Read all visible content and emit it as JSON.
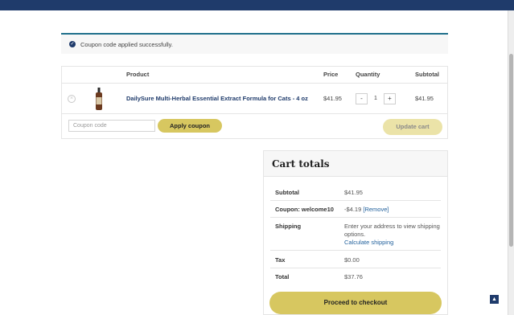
{
  "notice": {
    "message": "Coupon code applied successfully."
  },
  "cart": {
    "headers": {
      "product": "Product",
      "price": "Price",
      "quantity": "Quantity",
      "subtotal": "Subtotal"
    },
    "item": {
      "name": "DailySure Multi-Herbal Essential Extract Formula for Cats - 4 oz",
      "price": "$41.95",
      "quantity": "1",
      "subtotal": "$41.95",
      "minus": "-",
      "plus": "+"
    },
    "coupon_placeholder": "Coupon code",
    "apply_label": "Apply coupon",
    "update_label": "Update cart"
  },
  "totals": {
    "title": "Cart totals",
    "rows": {
      "subtotal": {
        "label": "Subtotal",
        "value": "$41.95"
      },
      "coupon": {
        "label": "Coupon: welcome10",
        "value": "-$4.19",
        "remove": "[Remove]"
      },
      "shipping": {
        "label": "Shipping",
        "value": "Enter your address to view shipping options.",
        "link": "Calculate shipping"
      },
      "tax": {
        "label": "Tax",
        "value": "$0.00"
      },
      "total": {
        "label": "Total",
        "value": "$37.76"
      }
    },
    "checkout_label": "Proceed to checkout"
  },
  "colors": {
    "header": "#1f3b6b",
    "button": "#d7c760",
    "link": "#1f5f9b"
  }
}
